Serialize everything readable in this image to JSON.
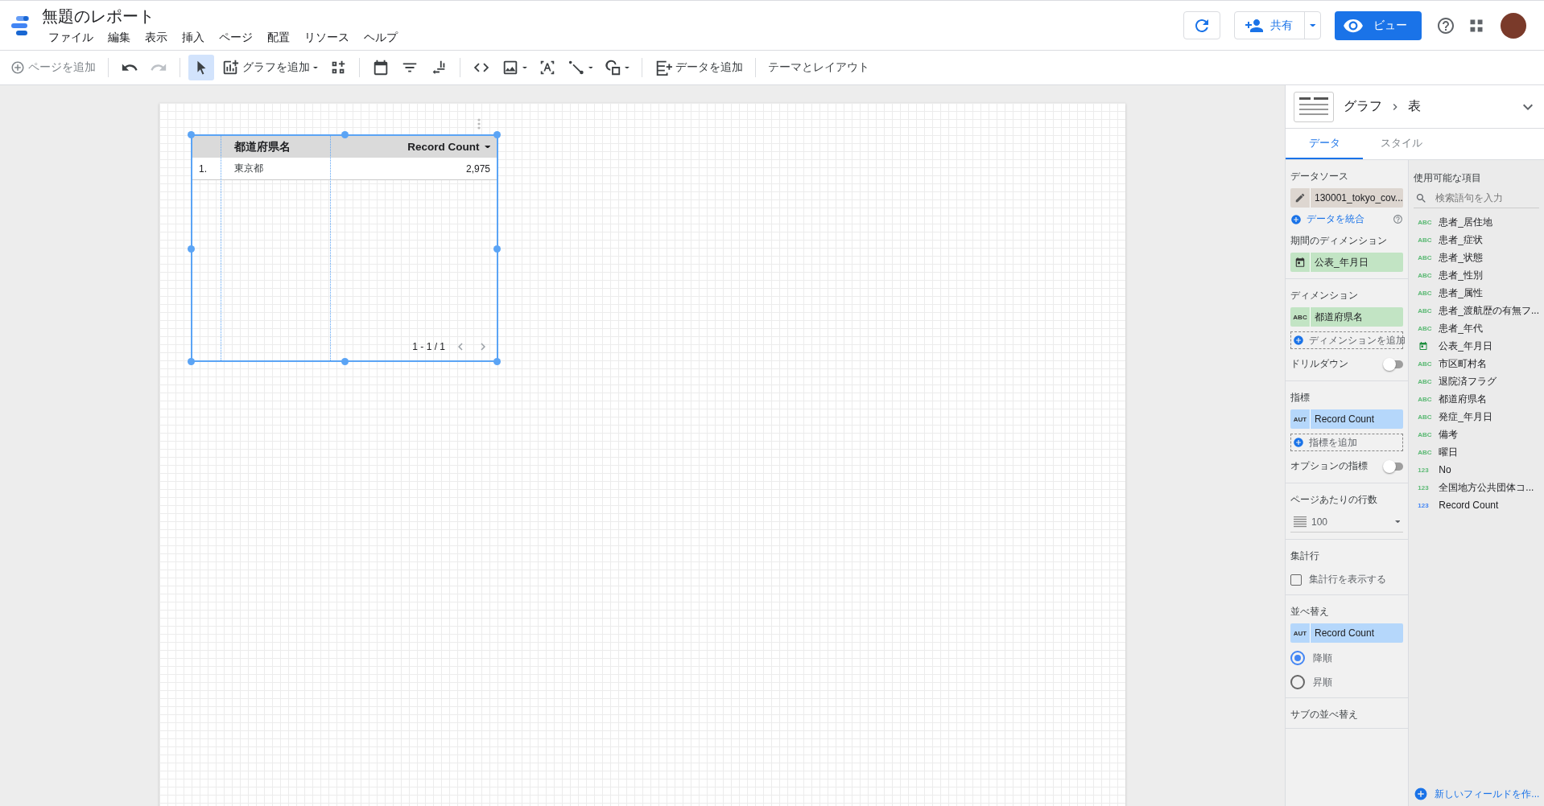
{
  "header": {
    "title": "無題のレポート",
    "menu": [
      "ファイル",
      "編集",
      "表示",
      "挿入",
      "ページ",
      "配置",
      "リソース",
      "ヘルプ"
    ],
    "share_label": "共有",
    "view_label": "ビュー"
  },
  "toolbar": {
    "add_page": "ページを追加",
    "tools": [
      {
        "kind": "undo",
        "selected": false,
        "disabled": false
      },
      {
        "kind": "redo",
        "selected": false,
        "disabled": true
      },
      {
        "kind": "select",
        "selected": true,
        "disabled": false
      },
      {
        "kind": "chart",
        "label": "グラフを追加",
        "selected": false,
        "disabled": false
      },
      {
        "kind": "component",
        "selected": false,
        "disabled": false
      },
      {
        "kind": "date",
        "selected": false,
        "disabled": false
      },
      {
        "kind": "filter",
        "selected": false,
        "disabled": false
      },
      {
        "kind": "control",
        "selected": false,
        "disabled": false
      },
      {
        "kind": "code",
        "selected": false,
        "disabled": false
      },
      {
        "kind": "image",
        "selected": false,
        "disabled": false
      },
      {
        "kind": "textbox",
        "selected": false,
        "disabled": false
      },
      {
        "kind": "line",
        "selected": false,
        "disabled": false
      },
      {
        "kind": "shape",
        "selected": false,
        "disabled": false
      },
      {
        "kind": "data",
        "label": "データを追加",
        "selected": false,
        "disabled": false
      }
    ],
    "theme_label": "テーマとレイアウト"
  },
  "table": {
    "columns": [
      {
        "label": "都道府県名",
        "sorted": false
      },
      {
        "label": "Record Count",
        "sorted": true
      }
    ],
    "rows": [
      {
        "number": "1.",
        "cells": [
          "東京都",
          "2,975"
        ]
      }
    ],
    "pagination": "1 - 1 / 1"
  },
  "panel": {
    "breadcrumb": [
      "グラフ",
      "表"
    ],
    "tabs": [
      {
        "label": "データ",
        "selected": true
      },
      {
        "label": "スタイル",
        "selected": false
      }
    ],
    "sections": [
      [
        {
          "kind": "heading",
          "label": "データソース"
        },
        {
          "kind": "source",
          "label": "130001_tokyo_cov..."
        },
        {
          "kind": "blend",
          "label": "データを統合"
        },
        {
          "kind": "heading",
          "label": "期間のディメンション"
        },
        {
          "kind": "date",
          "label": "公表_年月日"
        }
      ],
      [
        {
          "kind": "heading",
          "label": "ディメンション"
        },
        {
          "kind": "dimension",
          "badge": "ABC",
          "label": "都道府県名"
        },
        {
          "kind": "add",
          "label": "ディメンションを追加"
        },
        {
          "kind": "toggle",
          "label": "ドリルダウン",
          "on": false
        }
      ],
      [
        {
          "kind": "heading",
          "label": "指標"
        },
        {
          "kind": "metric",
          "badge": "AUT",
          "label": "Record Count"
        },
        {
          "kind": "add",
          "label": "指標を追加"
        },
        {
          "kind": "toggle",
          "label": "オプションの指標",
          "on": false
        }
      ],
      [
        {
          "kind": "heading",
          "label": "ページあたりの行数"
        },
        {
          "kind": "rows",
          "label": "100"
        }
      ],
      [
        {
          "kind": "heading",
          "label": "集計行"
        },
        {
          "kind": "checkbox",
          "label": "集計行を表示する",
          "checked": false
        }
      ],
      [
        {
          "kind": "heading",
          "label": "並べ替え"
        },
        {
          "kind": "metric",
          "badge": "AUT",
          "label": "Record Count"
        },
        {
          "kind": "radio",
          "label": "降順",
          "selected": true
        },
        {
          "kind": "radio",
          "label": "昇順",
          "selected": false
        }
      ],
      [
        {
          "kind": "heading",
          "label": "サブの並べ替え"
        }
      ]
    ],
    "available": {
      "heading": "使用可能な項目",
      "search_placeholder": "検索語句を入力",
      "fields": [
        {
          "kind": "dimension",
          "badge": "ABC",
          "label": "患者_居住地"
        },
        {
          "kind": "dimension",
          "badge": "ABC",
          "label": "患者_症状"
        },
        {
          "kind": "dimension",
          "badge": "ABC",
          "label": "患者_状態"
        },
        {
          "kind": "dimension",
          "badge": "ABC",
          "label": "患者_性別"
        },
        {
          "kind": "dimension",
          "badge": "ABC",
          "label": "患者_属性"
        },
        {
          "kind": "dimension",
          "badge": "ABC",
          "label": "患者_渡航歴の有無フ..."
        },
        {
          "kind": "dimension",
          "badge": "ABC",
          "label": "患者_年代"
        },
        {
          "kind": "date",
          "label": "公表_年月日"
        },
        {
          "kind": "dimension",
          "badge": "ABC",
          "label": "市区町村名"
        },
        {
          "kind": "dimension",
          "badge": "ABC",
          "label": "退院済フラグ"
        },
        {
          "kind": "dimension",
          "badge": "ABC",
          "label": "都道府県名"
        },
        {
          "kind": "dimension",
          "badge": "ABC",
          "label": "発症_年月日"
        },
        {
          "kind": "dimension",
          "badge": "ABC",
          "label": "備考"
        },
        {
          "kind": "dimension",
          "badge": "ABC",
          "label": "曜日"
        },
        {
          "kind": "dimension",
          "badge": "123",
          "label": "No"
        },
        {
          "kind": "dimension",
          "badge": "123",
          "label": "全国地方公共団体コ..."
        },
        {
          "kind": "metric",
          "badge": "123",
          "label": "Record Count"
        }
      ],
      "new_field": "新しいフィールドを作..."
    }
  }
}
